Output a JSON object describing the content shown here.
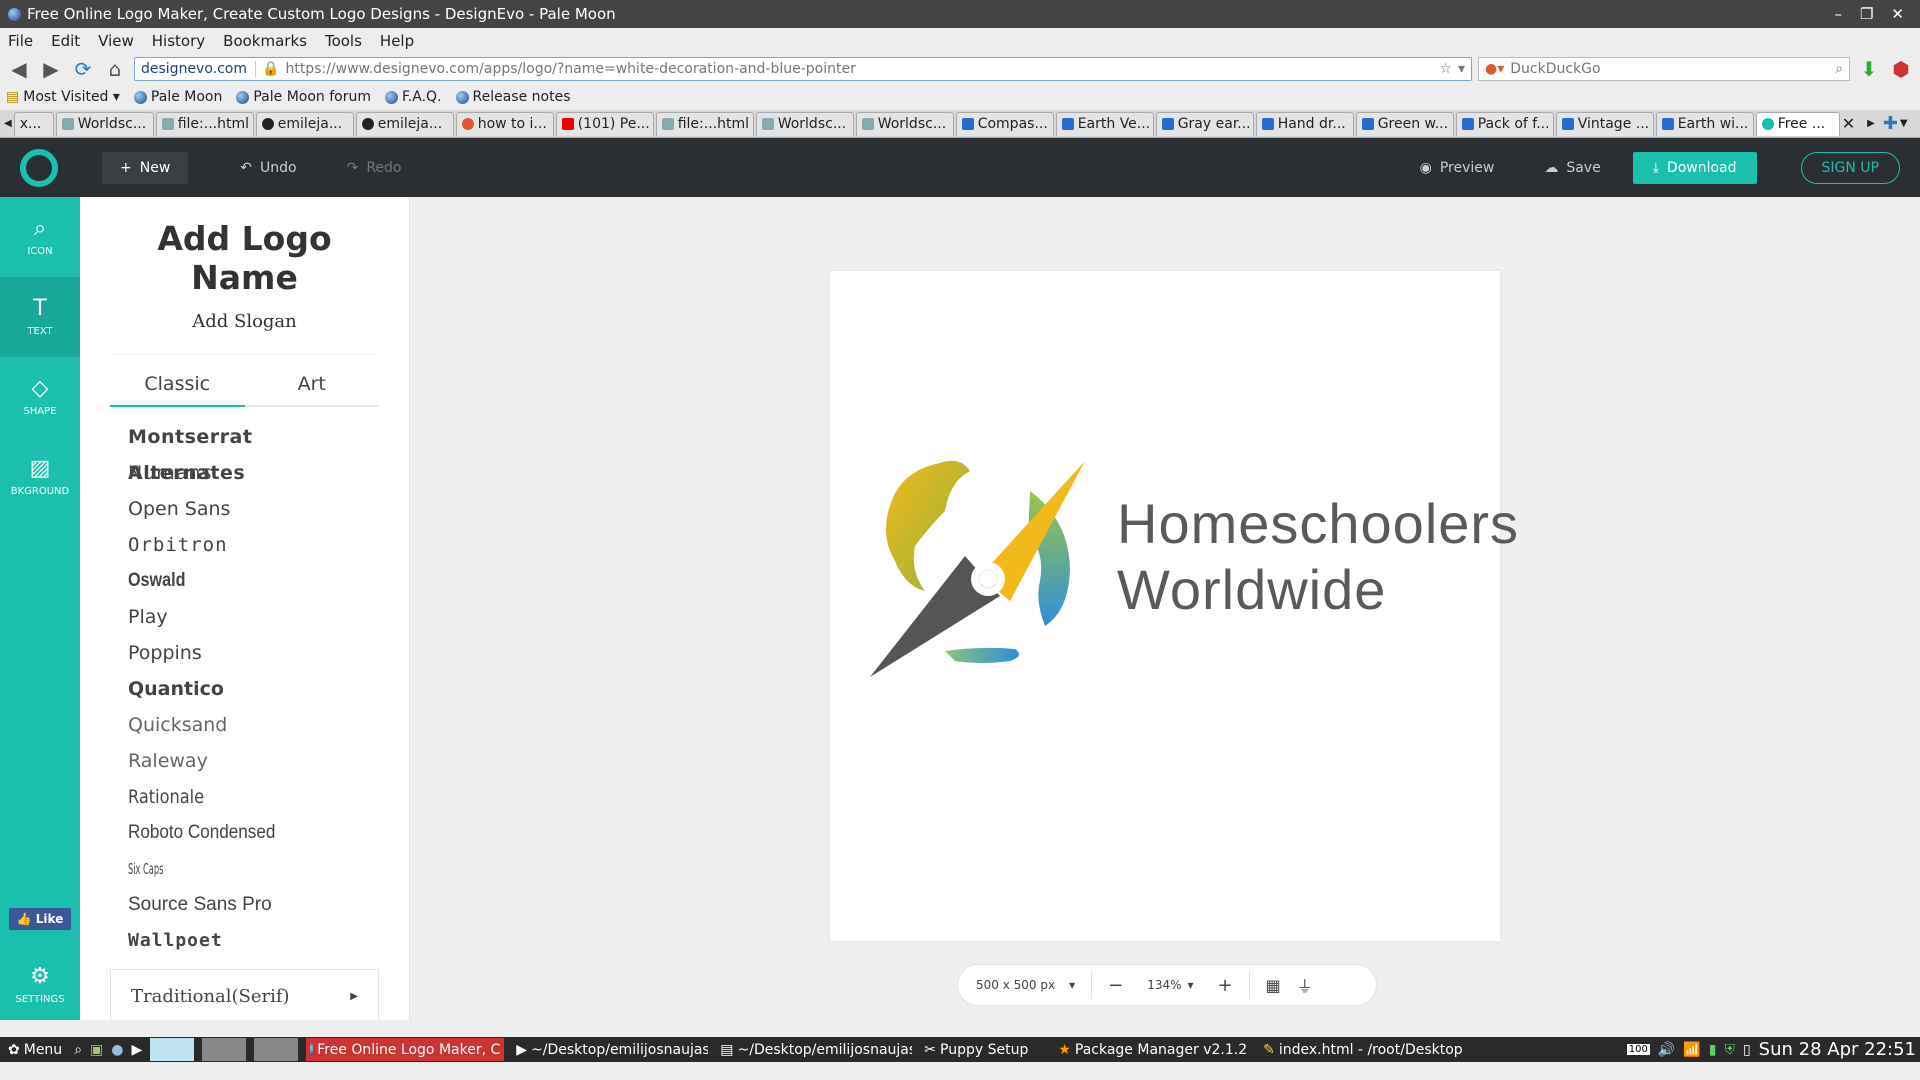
{
  "window": {
    "title": "Free Online Logo Maker, Create Custom Logo Designs - DesignEvo - Pale Moon"
  },
  "menubar": [
    "File",
    "Edit",
    "View",
    "History",
    "Bookmarks",
    "Tools",
    "Help"
  ],
  "address": {
    "host": "designevo.com",
    "url": "https://www.designevo.com/apps/logo/?name=white-decoration-and-blue-pointer"
  },
  "search": {
    "placeholder": "DuckDuckGo"
  },
  "bookmarks": [
    "Most Visited ▾",
    "Pale Moon",
    "Pale Moon forum",
    "F.A.Q.",
    "Release notes"
  ],
  "tabs": [
    "x...",
    "Worldsc...",
    "file:...html",
    "emileja...",
    "emileja...",
    "how to i...",
    "(101) Pe...",
    "file:...html",
    "Worldsc...",
    "Worldsc...",
    "Compas...",
    "Earth Ve...",
    "Gray ear...",
    "Hand dr...",
    "Green w...",
    "Pack of f...",
    "Vintage ...",
    "Earth wi...",
    "Free ..."
  ],
  "toolbar": {
    "new": "New",
    "undo": "Undo",
    "redo": "Redo",
    "preview": "Preview",
    "save": "Save",
    "download": "Download",
    "signup": "SIGN UP"
  },
  "rail": {
    "icon": "ICON",
    "text": "TEXT",
    "shape": "SHAPE",
    "background": "BKGROUND",
    "like": "Like",
    "settings": "SETTINGS"
  },
  "panel": {
    "title": "Add Logo Name",
    "slogan": "Add Slogan",
    "tab_classic": "Classic",
    "tab_art": "Art",
    "fonts": [
      "Montserrat Alternates",
      "Numans",
      "Open Sans",
      "Orbitron",
      "Oswald",
      "Play",
      "Poppins",
      "Quantico",
      "Quicksand",
      "Raleway",
      "Rationale",
      "Roboto Condensed",
      "Six Caps",
      "Source Sans Pro",
      "Wallpoet"
    ],
    "section": "Traditional(Serif)"
  },
  "canvas": {
    "line1": "Homeschoolers",
    "line2": "Worldwide"
  },
  "zoom": {
    "size": "500 x 500 px",
    "level": "134%"
  },
  "taskbar": {
    "menu": "Menu",
    "items": [
      "Free Online Logo Maker, C",
      "~/Desktop/emilijosnaujas",
      "~/Desktop/emilijosnaujas",
      "Puppy Setup",
      "Package Manager v2.1.2",
      "index.html - /root/Desktop"
    ],
    "battery": "100",
    "clock": "Sun 28 Apr 22:51"
  },
  "colors": {
    "accent": "#1bbfae",
    "appbar": "#2b2e33",
    "yellow": "#f2b91c",
    "blue": "#2f8fd8",
    "dark": "#555555"
  }
}
